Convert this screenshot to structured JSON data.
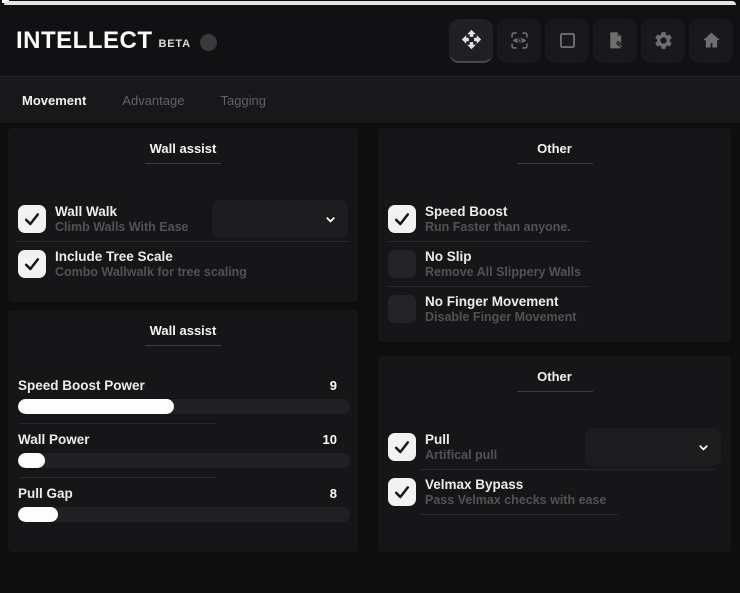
{
  "header": {
    "title": "INTELLECT",
    "badge": "BETA",
    "icons": [
      {
        "name": "move",
        "active": true
      },
      {
        "name": "aim-eye",
        "active": false
      },
      {
        "name": "esp-box",
        "active": false
      },
      {
        "name": "script-file",
        "active": false
      },
      {
        "name": "settings-gear",
        "active": false
      },
      {
        "name": "home",
        "active": false
      }
    ]
  },
  "tabs": [
    {
      "label": "Movement",
      "active": true
    },
    {
      "label": "Advantage",
      "active": false
    },
    {
      "label": "Tagging",
      "active": false
    }
  ],
  "left_top": {
    "title": "Wall assist",
    "rows": [
      {
        "label": "Wall Walk",
        "desc": "Climb Walls With Ease",
        "checked": true,
        "dropdown_value": ""
      },
      {
        "label": "Include Tree Scale",
        "desc": "Combo Wallwalk for tree scaling",
        "checked": true
      }
    ]
  },
  "left_bottom": {
    "title": "Wall assist",
    "sliders": [
      {
        "label": "Speed Boost Power",
        "value": "9",
        "fill_pct": 47
      },
      {
        "label": "Wall Power",
        "value": "10",
        "fill_pct": 8
      },
      {
        "label": "Pull Gap",
        "value": "8",
        "fill_pct": 12
      }
    ]
  },
  "right_top": {
    "title": "Other",
    "rows": [
      {
        "label": "Speed Boost",
        "desc": "Run Faster than anyone.",
        "checked": true
      },
      {
        "label": "No Slip",
        "desc": "Remove All Slippery Walls",
        "checked": false
      },
      {
        "label": "No Finger Movement",
        "desc": "Disable Finger Movement",
        "checked": false
      }
    ]
  },
  "right_bottom": {
    "title": "Other",
    "rows": [
      {
        "label": "Pull",
        "desc": "Artifical pull",
        "checked": true,
        "dropdown_value": ""
      },
      {
        "label": "Velmax Bypass",
        "desc": "Pass Velmax checks with ease",
        "checked": true
      }
    ]
  },
  "colors": {
    "window_bg": "#0e0e0f",
    "panel_bg": "#161618",
    "checkbox_checked": "#f2f2f2",
    "slider_fill": "#fdfdfd",
    "muted_text": "#525255"
  }
}
